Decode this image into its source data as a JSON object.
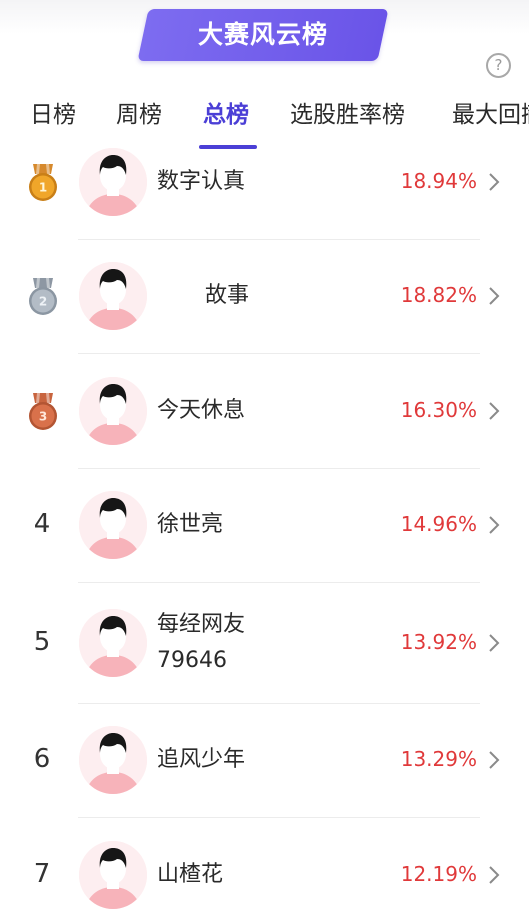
{
  "header": {
    "title": "大赛风云榜",
    "help_label": "?"
  },
  "tabs": [
    {
      "label": "日榜",
      "active": false
    },
    {
      "label": "周榜",
      "active": false
    },
    {
      "label": "总榜",
      "active": true
    },
    {
      "label": "选股胜率榜",
      "active": false
    },
    {
      "label": "最大回撤",
      "active": false
    }
  ],
  "rankings": [
    {
      "rank": "1",
      "medal": "gold",
      "name": "数字认真",
      "name2": "",
      "return": "18.94%"
    },
    {
      "rank": "2",
      "medal": "silver",
      "name": "故事",
      "name2": "",
      "return": "18.82%"
    },
    {
      "rank": "3",
      "medal": "bronze",
      "name": "今天休息",
      "name2": "",
      "return": "16.30%"
    },
    {
      "rank": "4",
      "medal": "",
      "name": "徐世亮",
      "name2": "",
      "return": "14.96%"
    },
    {
      "rank": "5",
      "medal": "",
      "name": "每经网友",
      "name2": "79646",
      "return": "13.92%"
    },
    {
      "rank": "6",
      "medal": "",
      "name": "追风少年",
      "name2": "",
      "return": "13.29%"
    },
    {
      "rank": "7",
      "medal": "",
      "name": "山楂花",
      "name2": "",
      "return": "12.19%"
    }
  ],
  "colors": {
    "accent": "#4b3fd6",
    "return_red": "#e0393a",
    "banner": "#6a54e8"
  }
}
